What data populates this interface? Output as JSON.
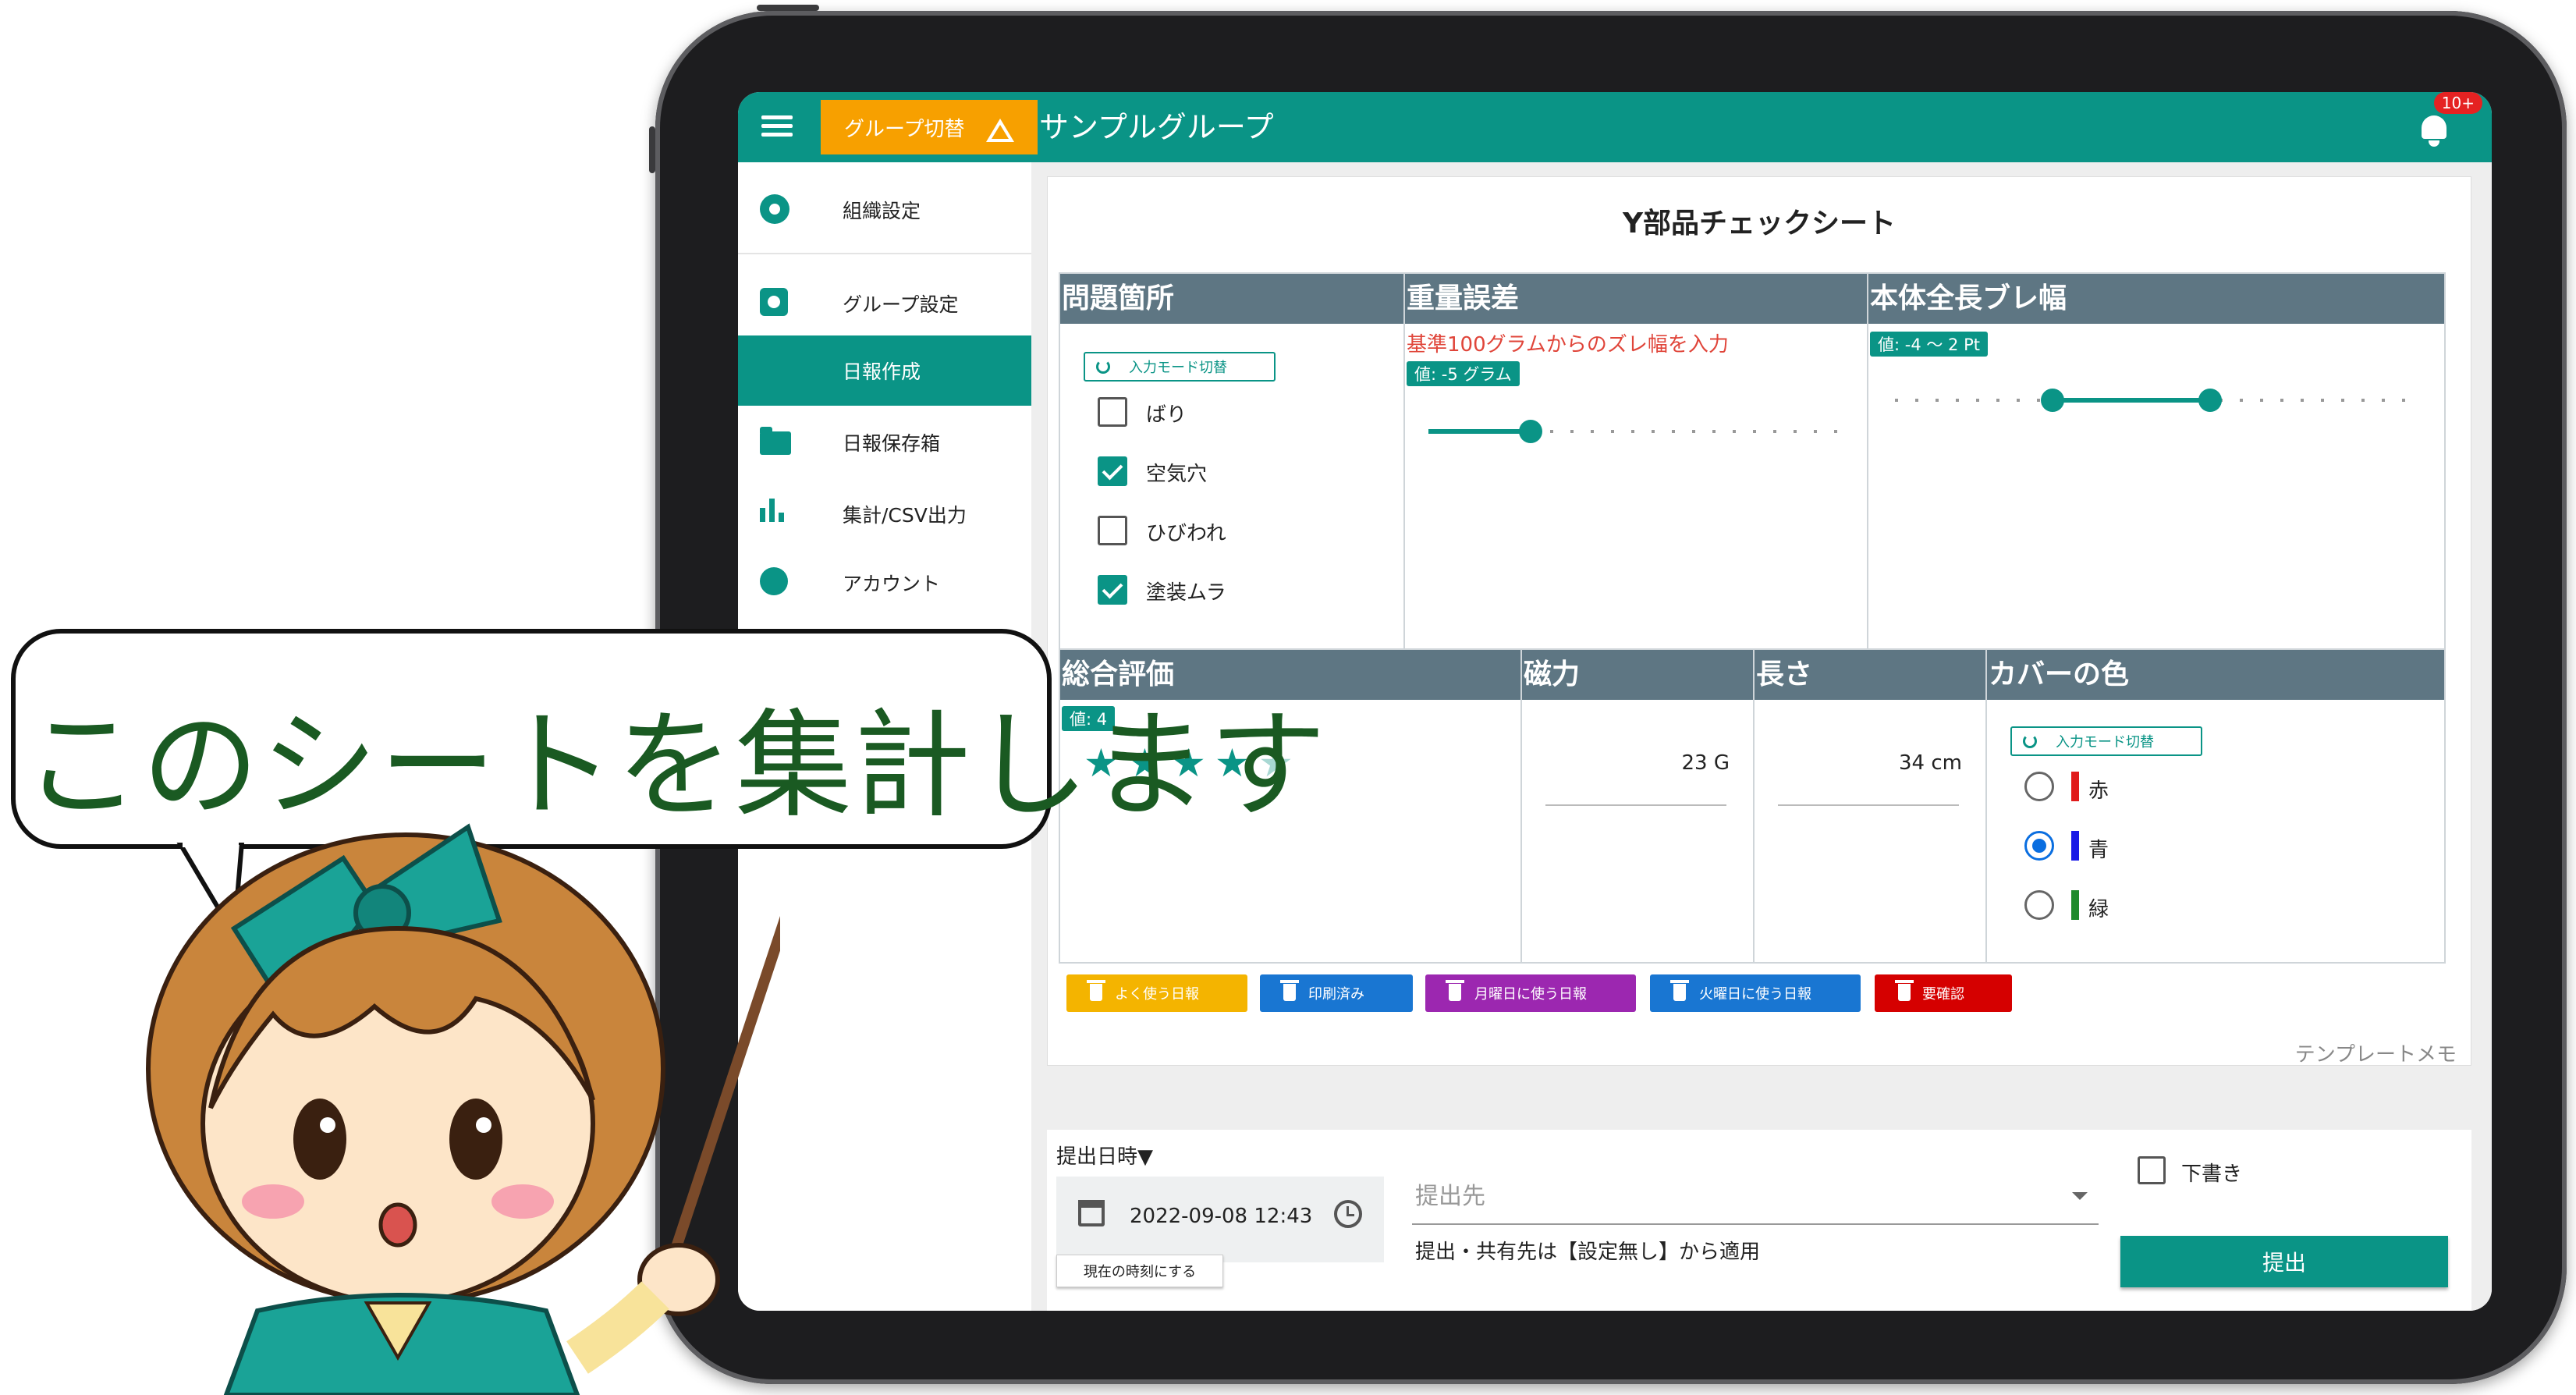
{
  "topbar": {
    "group_switch_label": "グループ切替",
    "group_name": "サンプルグループ",
    "notification_badge": "10+"
  },
  "sidebar": {
    "items": [
      {
        "label": "組織設定",
        "icon": "gear-icon"
      },
      {
        "label": "グループ設定",
        "icon": "settings-icon"
      },
      {
        "label": "日報作成",
        "icon": "",
        "active": true
      },
      {
        "label": "日報保存箱",
        "icon": "folder-icon"
      },
      {
        "label": "集計/CSV出力",
        "icon": "bar-chart-icon"
      },
      {
        "label": "アカウント",
        "icon": "account-icon"
      }
    ]
  },
  "sheet": {
    "title": "Y部品チェックシート",
    "problem_area": {
      "header": "問題箇所",
      "mode_switch": "入力モード切替",
      "options": [
        {
          "label": "ばり",
          "checked": false
        },
        {
          "label": "空気穴",
          "checked": true
        },
        {
          "label": "ひびわれ",
          "checked": false
        },
        {
          "label": "塗装ムラ",
          "checked": true
        }
      ]
    },
    "weight_error": {
      "header": "重量誤差",
      "note": "基準100グラムからのズレ幅を入力",
      "value_tag": "値: -5 グラム",
      "value": -5
    },
    "length_range": {
      "header": "本体全長ブレ幅",
      "value_tag": "値: -4 〜 2 Pt",
      "low": -4,
      "high": 2
    },
    "overall": {
      "header": "総合評価",
      "value_tag": "値: 4",
      "rating": 4,
      "max": 5
    },
    "magnetism": {
      "header": "磁力",
      "value": "23 G"
    },
    "length": {
      "header": "長さ",
      "value": "34 cm"
    },
    "cover_color": {
      "header": "カバーの色",
      "mode_switch": "入力モード切替",
      "options": [
        {
          "label": "赤",
          "color": "#e01b1b",
          "selected": false
        },
        {
          "label": "青",
          "color": "#1a1ae6",
          "selected": true
        },
        {
          "label": "緑",
          "color": "#1f8a2c",
          "selected": false
        }
      ]
    },
    "memos": [
      {
        "label": "よく使う日報",
        "color": "#f4b400"
      },
      {
        "label": "印刷済み",
        "color": "#1976d2"
      },
      {
        "label": "月曜日に使う日報",
        "color": "#9c27b0"
      },
      {
        "label": "火曜日に使う日報",
        "color": "#1976d2"
      },
      {
        "label": "要確認",
        "color": "#d50000"
      }
    ],
    "template_memo": "テンプレートメモ"
  },
  "submit": {
    "datetime_label": "提出日時▼",
    "datetime_value": "2022-09-08 12:43",
    "now_button": "現在の時刻にする",
    "destination_placeholder": "提出先",
    "destination_note": "提出・共有先は【設定無し】から適用",
    "draft_label": "下書き",
    "submit_button": "提出"
  },
  "overlay": {
    "speech": "このシートを集計します"
  },
  "colors": {
    "accent": "#0a9486",
    "switch_orange": "#f7a000",
    "header_gray": "#5e7683"
  }
}
